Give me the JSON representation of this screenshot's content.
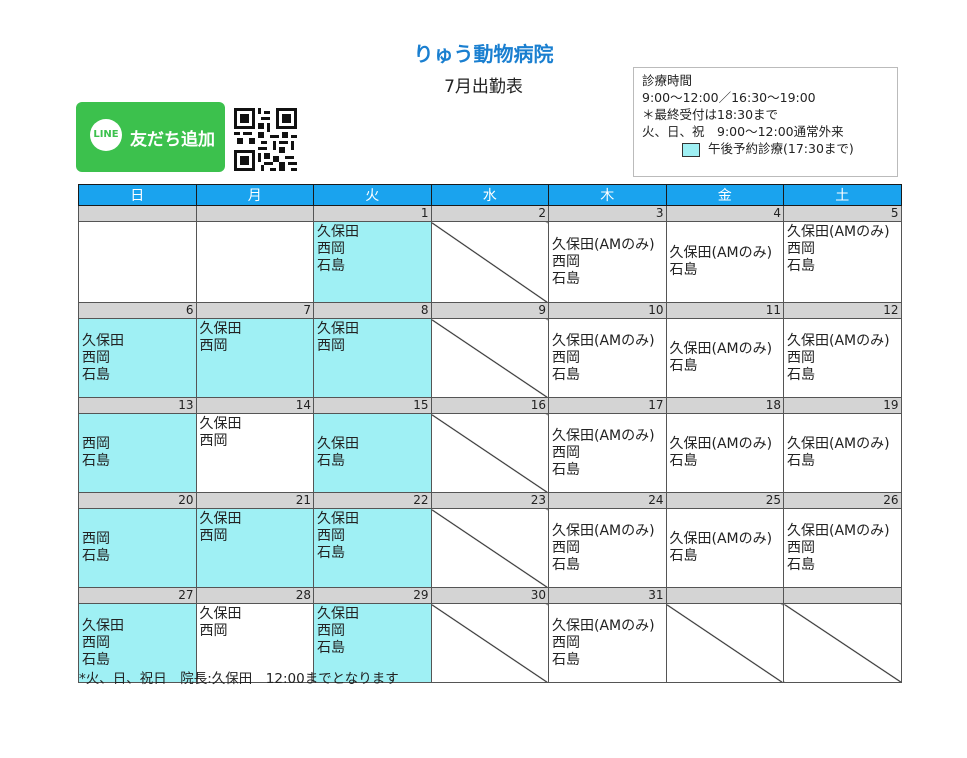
{
  "title": "りゅう動物病院",
  "subtitle": "7月出勤表",
  "hours": {
    "heading": "診療時間",
    "line1": "9:00～12:00／16:30～19:00",
    "line2": "＊最終受付は18:30まで",
    "line3": "火、日、祝　9:00～12:00通常外来",
    "legend": "午後予約診療(17:30まで)"
  },
  "line_button": {
    "logo": "LINE",
    "label": "友だち追加"
  },
  "colors": {
    "title": "#1a7fd0",
    "header": "#1aa3ee",
    "afternoon": "#9ff0f4",
    "line_green": "#3cc14d"
  },
  "weekdays": [
    "日",
    "月",
    "火",
    "水",
    "木",
    "金",
    "土"
  ],
  "weeks": [
    {
      "days": [
        "",
        "",
        "1",
        "2",
        "3",
        "4",
        "5"
      ],
      "cells": [
        {
          "t": ""
        },
        {
          "t": ""
        },
        {
          "t": "久保田\n西岡\n石島",
          "c": 1,
          "top": 1
        },
        {
          "x": 1
        },
        {
          "t": "久保田(AMのみ)\n西岡\n石島"
        },
        {
          "t": "久保田(AMのみ)\n石島"
        },
        {
          "t": "久保田(AMのみ)\n西岡\n石島",
          "top": 1
        }
      ]
    },
    {
      "days": [
        "6",
        "7",
        "8",
        "9",
        "10",
        "11",
        "12"
      ],
      "cells": [
        {
          "t": "久保田\n西岡\n石島",
          "c": 1
        },
        {
          "t": "久保田\n西岡",
          "c": 1,
          "top": 1
        },
        {
          "t": "久保田\n西岡",
          "c": 1,
          "top": 1
        },
        {
          "x": 1
        },
        {
          "t": "久保田(AMのみ)\n西岡\n石島"
        },
        {
          "t": "久保田(AMのみ)\n石島"
        },
        {
          "t": "久保田(AMのみ)\n西岡\n石島"
        }
      ]
    },
    {
      "days": [
        "13",
        "14",
        "15",
        "16",
        "17",
        "18",
        "19"
      ],
      "cells": [
        {
          "t": "西岡\n石島",
          "c": 1
        },
        {
          "t": "久保田\n西岡",
          "top": 1
        },
        {
          "t": "久保田\n石島",
          "c": 1
        },
        {
          "x": 1
        },
        {
          "t": "久保田(AMのみ)\n西岡\n石島"
        },
        {
          "t": "久保田(AMのみ)\n石島"
        },
        {
          "t": "久保田(AMのみ)\n石島"
        }
      ]
    },
    {
      "days": [
        "20",
        "21",
        "22",
        "23",
        "24",
        "25",
        "26"
      ],
      "cells": [
        {
          "t": "西岡\n石島",
          "c": 1
        },
        {
          "t": "久保田\n西岡",
          "c": 1,
          "top": 1
        },
        {
          "t": "久保田\n西岡\n石島",
          "c": 1,
          "top": 1
        },
        {
          "x": 1
        },
        {
          "t": "久保田(AMのみ)\n西岡\n石島"
        },
        {
          "t": "久保田(AMのみ)\n石島"
        },
        {
          "t": "久保田(AMのみ)\n西岡\n石島"
        }
      ]
    },
    {
      "days": [
        "27",
        "28",
        "29",
        "30",
        "31",
        "",
        ""
      ],
      "cells": [
        {
          "t": "久保田\n西岡\n石島",
          "c": 1
        },
        {
          "t": "久保田\n西岡",
          "top": 1
        },
        {
          "t": "久保田\n西岡\n石島",
          "c": 1,
          "top": 1
        },
        {
          "x": 1
        },
        {
          "t": "久保田(AMのみ)\n西岡\n石島"
        },
        {
          "x": 1
        },
        {
          "x": 1
        }
      ]
    }
  ],
  "note": "*火、日、祝日　院長:久保田　12:00までとなります"
}
